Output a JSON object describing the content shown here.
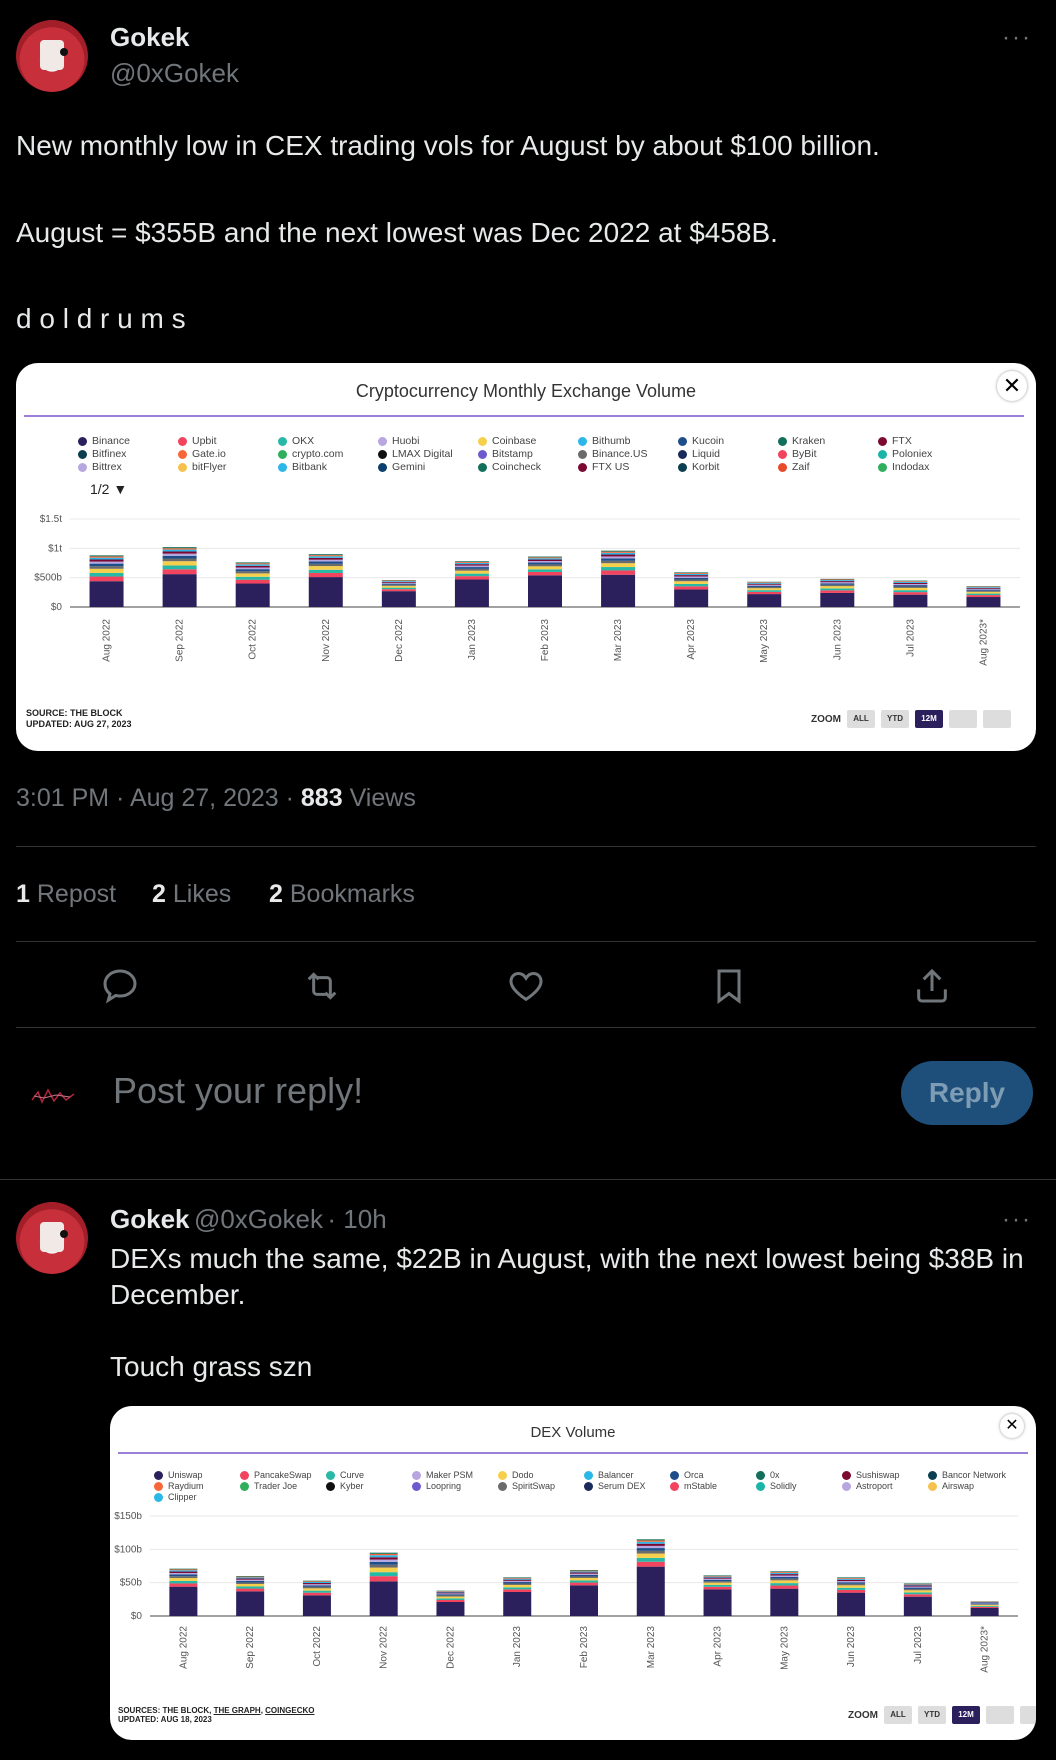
{
  "tweet": {
    "author_name": "Gokek",
    "author_handle": "@0xGokek",
    "more": "···",
    "text_line1": "New monthly low in CEX trading vols for August by about $100 billion.",
    "text_line2": "August = $355B and the next lowest was Dec 2022 at $458B.",
    "text_line3": "d o l d r u m s",
    "time": "3:01 PM · Aug 27, 2023 · ",
    "views_count": "883",
    "views_label": "Views",
    "reposts_count": "1",
    "reposts_label": "Repost",
    "likes_count": "2",
    "likes_label": "Likes",
    "bookmarks_count": "2",
    "bookmarks_label": "Bookmarks"
  },
  "reply_box": {
    "placeholder": "Post your reply!",
    "button": "Reply"
  },
  "reply_tweet": {
    "author_name": "Gokek",
    "author_handle": "@0xGokek",
    "time": "· 10h",
    "more": "···",
    "text_line1": "DEXs much the same, $22B in August, with the next lowest being $38B in December.",
    "text_line2": "Touch grass szn"
  },
  "icons": {
    "reply": "reply-icon",
    "repost": "repost-icon",
    "like": "heart-icon",
    "bookmark": "bookmark-icon",
    "share": "share-icon"
  },
  "chart_data": [
    {
      "type": "bar",
      "title": "Cryptocurrency Monthly Exchange Volume",
      "legend_page": "1/2 ▼",
      "legend": [
        "Binance",
        "Upbit",
        "OKX",
        "Huobi",
        "Coinbase",
        "Bithumb",
        "Kucoin",
        "Kraken",
        "FTX",
        "Bitfinex",
        "Gate.io",
        "crypto.com",
        "LMAX Digital",
        "Bitstamp",
        "Binance.US",
        "Liquid",
        "ByBit",
        "Poloniex",
        "Bittrex",
        "bitFlyer",
        "Bitbank",
        "Gemini",
        "Coincheck",
        "FTX US",
        "Korbit",
        "Zaif",
        "Indodax"
      ],
      "legend_colors": [
        "#2b1f5c",
        "#f2435f",
        "#27b8a6",
        "#b7a6e0",
        "#f6d04d",
        "#2bb8e8",
        "#1d4e89",
        "#12705a",
        "#7a0a32",
        "#0b3f4f",
        "#f6683a",
        "#2fae5c",
        "#101010",
        "#6f5acd",
        "#6b6b6b",
        "#1a2a5a",
        "#f2435f",
        "#1bb5a8",
        "#b7a6e0",
        "#f6c24d",
        "#2bb8e8",
        "#0b3f6f",
        "#12705a",
        "#7a0a32",
        "#0b3f4f",
        "#e84a2a",
        "#2fae5c"
      ],
      "categories": [
        "Aug 2022",
        "Sep 2022",
        "Oct 2022",
        "Nov 2022",
        "Dec 2022",
        "Jan 2023",
        "Feb 2023",
        "Mar 2023",
        "Apr 2023",
        "May 2023",
        "Jun 2023",
        "Jul 2023",
        "Aug 2023*"
      ],
      "totals": [
        880,
        1020,
        760,
        900,
        458,
        780,
        860,
        960,
        590,
        430,
        480,
        450,
        355
      ],
      "binance": [
        440,
        560,
        400,
        510,
        270,
        470,
        540,
        550,
        300,
        220,
        240,
        210,
        170
      ],
      "yticks": [
        "$0",
        "$500b",
        "$1t",
        "$1.5t"
      ],
      "ylim": [
        0,
        1500
      ],
      "source": "SOURCE: THE BLOCK",
      "updated": "UPDATED: AUG 27, 2023",
      "zoom_label": "ZOOM",
      "zoom_buttons": [
        "ALL",
        "YTD",
        "12M",
        "",
        ""
      ]
    },
    {
      "type": "bar",
      "title": "DEX Volume",
      "legend": [
        "Uniswap",
        "PancakeSwap",
        "Curve",
        "Maker PSM",
        "Dodo",
        "Balancer",
        "Orca",
        "0x",
        "Sushiswap",
        "Bancor Network",
        "Raydium",
        "Trader Joe",
        "Kyber",
        "Loopring",
        "SpiritSwap",
        "Serum DEX",
        "mStable",
        "Solidly",
        "Astroport",
        "Airswap",
        "Clipper"
      ],
      "legend_colors": [
        "#2b1f5c",
        "#f2435f",
        "#27b8a6",
        "#b7a6e0",
        "#f6d04d",
        "#2bb8e8",
        "#1d4e89",
        "#12705a",
        "#7a0a32",
        "#0b3f4f",
        "#f6683a",
        "#2fae5c",
        "#101010",
        "#6f5acd",
        "#6b6b6b",
        "#1a2a5a",
        "#f2435f",
        "#1bb5a8",
        "#b7a6e0",
        "#f6c24d",
        "#2bb8e8"
      ],
      "categories": [
        "Aug 2022",
        "Sep 2022",
        "Oct 2022",
        "Nov 2022",
        "Dec 2022",
        "Jan 2023",
        "Feb 2023",
        "Mar 2023",
        "Apr 2023",
        "May 2023",
        "Jun 2023",
        "Jul 2023",
        "Aug 2023*"
      ],
      "totals": [
        71,
        60,
        53,
        95,
        38,
        58,
        69,
        115,
        61,
        67,
        58,
        49,
        22
      ],
      "uniswap": [
        44,
        37,
        31,
        52,
        21,
        36,
        46,
        74,
        40,
        41,
        35,
        29,
        12
      ],
      "yticks": [
        "$0",
        "$50b",
        "$100b",
        "$150b"
      ],
      "ylim": [
        0,
        150
      ],
      "source_prefix": "SOURCES: THE BLOCK, ",
      "source_link1": "THE GRAPH",
      "source_sep": ", ",
      "source_link2": "COINGECKO",
      "updated": "UPDATED: AUG 18, 2023",
      "zoom_label": "ZOOM",
      "zoom_buttons": [
        "ALL",
        "YTD",
        "12M",
        "",
        ""
      ]
    }
  ]
}
